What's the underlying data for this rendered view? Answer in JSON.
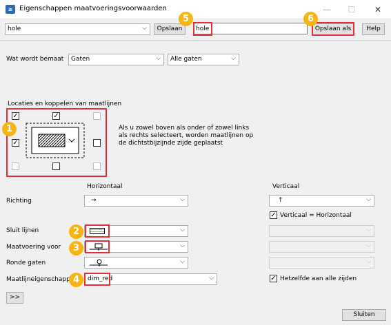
{
  "window": {
    "title": "Eigenschappen maatvoeringsvoorwaarden",
    "minimize": "—",
    "maximize": "☐",
    "close": "✕"
  },
  "toolbar": {
    "settings_value": "hole",
    "save_label": "Opslaan",
    "save_as_name": "hole",
    "save_as_label": "Opslaan als",
    "help_label": "Help"
  },
  "measure": {
    "label": "Wat wordt bemaat",
    "type_value": "Gaten",
    "scope_value": "Alle gaten"
  },
  "locations": {
    "group_label": "Locaties en koppelen van maatlijnen",
    "info_text": "Als u zowel boven als onder of zowel links als rechts selecteert, worden maatlijnen op de dichtstbijzijnde zijde geplaatst",
    "top_left": true,
    "top_center": true,
    "top_right": false,
    "mid_left": true,
    "mid_right": false,
    "bottom_left": false,
    "bottom_center": false,
    "bottom_right": false
  },
  "headers": {
    "horizontal": "Horizontaal",
    "vertical": "Verticaal"
  },
  "rows": {
    "direction_label": "Richting",
    "direction_h_icon": "→",
    "direction_v_icon": "↑",
    "vertical_equals_horizontal": "Verticaal = Horizontaal",
    "close_lines_label": "Sluit lijnen",
    "dimension_for_label": "Maatvoering voor",
    "round_holes_label": "Ronde gaten",
    "dim_props_label": "Maatlijneigenschapp",
    "dim_props_value": "dim_red",
    "same_all_sides": "Hetzelfde aan alle zijden"
  },
  "badges": [
    "1",
    "2",
    "3",
    "4",
    "5",
    "6"
  ],
  "footer": {
    "expand_label": ">>",
    "close_label": "Sluiten"
  },
  "colors": {
    "accent": "#e0303a",
    "badge": "#f6b515"
  }
}
